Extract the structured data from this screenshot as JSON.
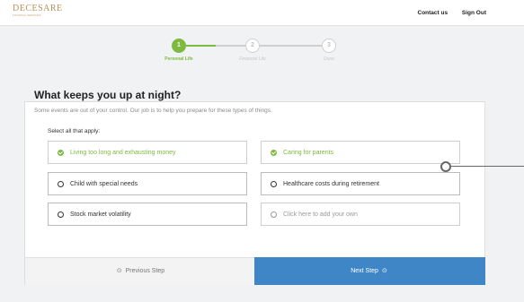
{
  "brand": {
    "logo_text": "DECESARE",
    "logo_subtext": "FINANCIAL SERVICES"
  },
  "header": {
    "contact_label": "Contact us",
    "signout_label": "Sign Out"
  },
  "stepper": {
    "steps": [
      {
        "number": "1",
        "label": "Personal Life",
        "state": "active"
      },
      {
        "number": "2",
        "label": "Financial Life",
        "state": "pending"
      },
      {
        "number": "3",
        "label": "Done",
        "state": "pending"
      }
    ]
  },
  "question": {
    "title": "What keeps you up at night?",
    "subtitle": "Some events are out of your control. Our job is to help you prepare for these types of things.",
    "select_prompt": "Select all that apply:"
  },
  "options": [
    {
      "label": "Living too long and exhausting money",
      "selected": true
    },
    {
      "label": "Caring for parents",
      "selected": true
    },
    {
      "label": "Child with special needs",
      "selected": false
    },
    {
      "label": "Healthcare costs during retirement",
      "selected": false
    },
    {
      "label": "Stock market volatility",
      "selected": false
    },
    {
      "label": "Click here to add your own",
      "selected": false
    }
  ],
  "nav": {
    "prev_label": "Previous Step",
    "next_label": "Next Step"
  },
  "colors": {
    "accent_green": "#7dba3f",
    "primary_blue": "#3e86c6",
    "brand_gold": "#b5905a"
  }
}
